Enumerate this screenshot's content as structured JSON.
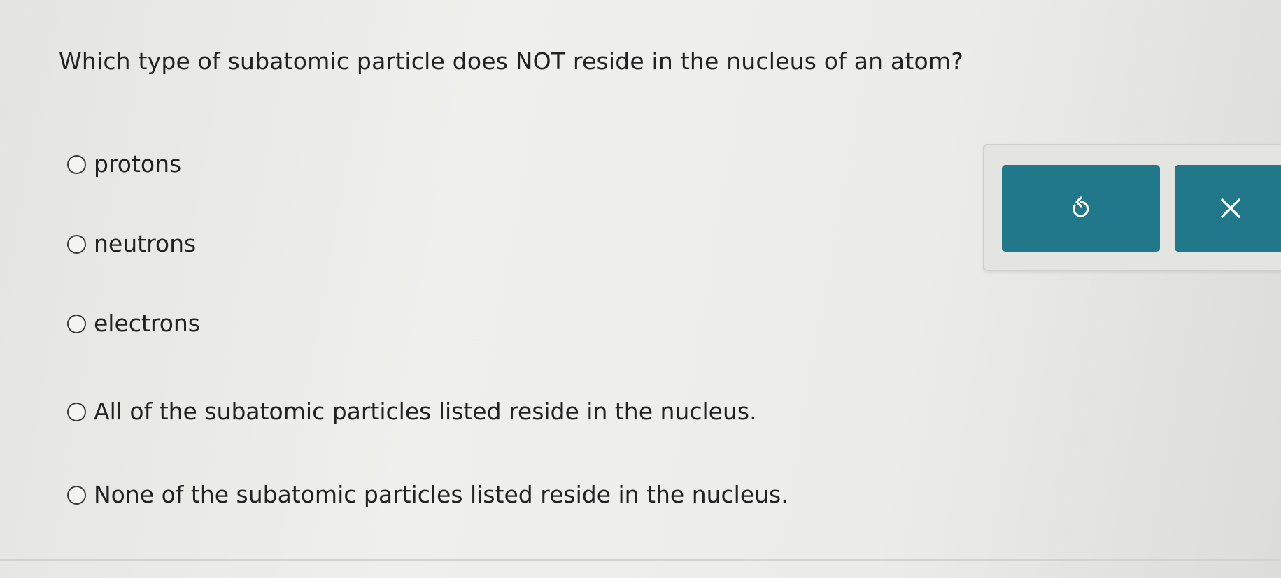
{
  "question": {
    "text": "Which type of subatomic particle does NOT reside in the nucleus of an atom?"
  },
  "choices": [
    {
      "label": "protons"
    },
    {
      "label": "neutrons"
    },
    {
      "label": "electrons"
    },
    {
      "label": "All of the subatomic particles listed reside in the nucleus."
    },
    {
      "label": "None of the subatomic particles listed reside in the nucleus."
    }
  ],
  "toolbar": {
    "undo_icon": "undo-icon",
    "close_icon": "close-icon",
    "button_color": "#20788a"
  }
}
